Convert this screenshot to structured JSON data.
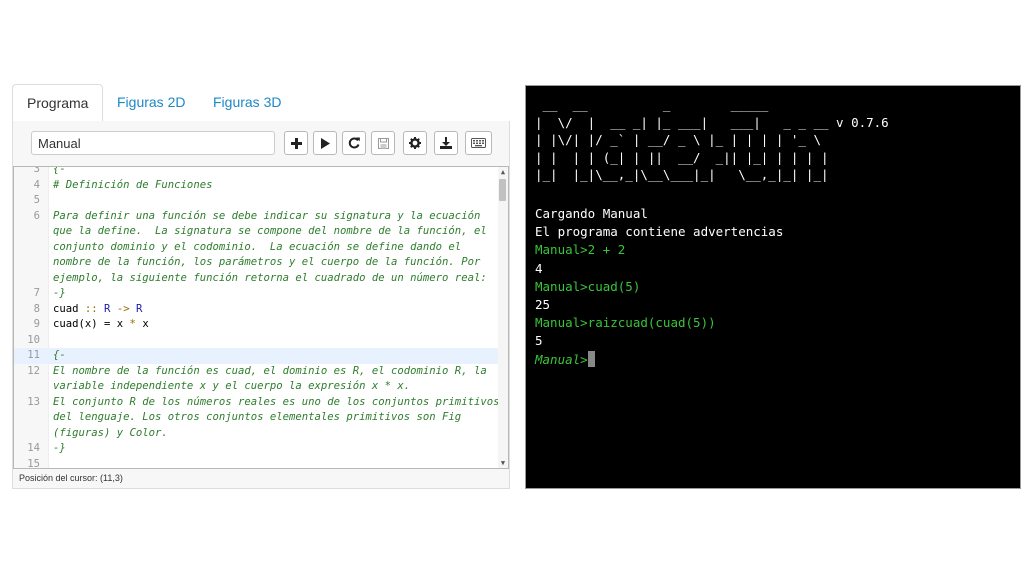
{
  "tabs": [
    "Programa",
    "Figuras 2D",
    "Figuras 3D"
  ],
  "program_name": "Manual",
  "toolbar_icons": [
    "plus-icon",
    "play-icon",
    "refresh-icon",
    "save-icon",
    "gear-icon",
    "download-icon",
    "keyboard-icon"
  ],
  "editor": {
    "lines": [
      {
        "num": "3",
        "code": "{-",
        "style": "comment"
      },
      {
        "num": "4",
        "code": "# Definición de Funciones",
        "style": "comment"
      },
      {
        "num": "5",
        "code": "",
        "style": "comment"
      },
      {
        "num": "6",
        "code": "Para definir una función se debe indicar su signatura y la ecuación",
        "style": "comment"
      },
      {
        "num": "",
        "code": "que la define.  La signatura se compone del nombre de la función, el",
        "style": "comment"
      },
      {
        "num": "",
        "code": "conjunto dominio y el codominio.  La ecuación se define dando el",
        "style": "comment"
      },
      {
        "num": "",
        "code": "nombre de la función, los parámetros y el cuerpo de la función. Por",
        "style": "comment"
      },
      {
        "num": "",
        "code": "ejemplo, la siguiente función retorna el cuadrado de un número real:",
        "style": "comment"
      },
      {
        "num": "7",
        "code": "-}",
        "style": "comment"
      },
      {
        "num": "8",
        "code": "cuad :: R -> R",
        "style": "sig"
      },
      {
        "num": "9",
        "code": "cuad(x) = x * x",
        "style": "def"
      },
      {
        "num": "10",
        "code": "",
        "style": "plain"
      },
      {
        "num": "11",
        "code": "{-",
        "style": "comment"
      },
      {
        "num": "12",
        "code": "El nombre de la función es cuad, el dominio es R, el codominio R, la",
        "style": "comment"
      },
      {
        "num": "",
        "code": "variable independiente x y el cuerpo la expresión x * x.",
        "style": "comment"
      },
      {
        "num": "13",
        "code": "El conjunto R de los números reales es uno de los conjuntos primitivos",
        "style": "comment"
      },
      {
        "num": "",
        "code": "del lenguaje. Los otros conjuntos elementales primitivos son Fig",
        "style": "comment"
      },
      {
        "num": "",
        "code": "(figuras) y Color.",
        "style": "comment"
      },
      {
        "num": "14",
        "code": "-}",
        "style": "comment"
      },
      {
        "num": "15",
        "code": "",
        "style": "plain"
      }
    ]
  },
  "status": "Posición del cursor: (11,3)",
  "terminal": {
    "banner": [
      " __  __          _        _____",
      "|  \\/  |  __ _| |_ ___|   ___|   _ _ __ v 0.7.6",
      "| |\\/| |/ _` | __/ _ \\ |_ | | | | '_ \\",
      "| |  | | (_| | ||  __/  _|| |_| | | | |",
      "|_|  |_|\\__,_|\\__\\___|_|   \\__,_|_| |_|"
    ],
    "lines": [
      {
        "text": "Cargando Manual",
        "style": "white"
      },
      {
        "text": "El programa contiene advertencias",
        "style": "white"
      },
      {
        "text": "Manual>2 + 2",
        "style": "green"
      },
      {
        "text": "4",
        "style": "white"
      },
      {
        "text": "Manual>cuad(5)",
        "style": "green"
      },
      {
        "text": "25",
        "style": "white"
      },
      {
        "text": "Manual>raizcuad(cuad(5))",
        "style": "green"
      },
      {
        "text": "5",
        "style": "white"
      }
    ],
    "prompt": "Manual>"
  }
}
